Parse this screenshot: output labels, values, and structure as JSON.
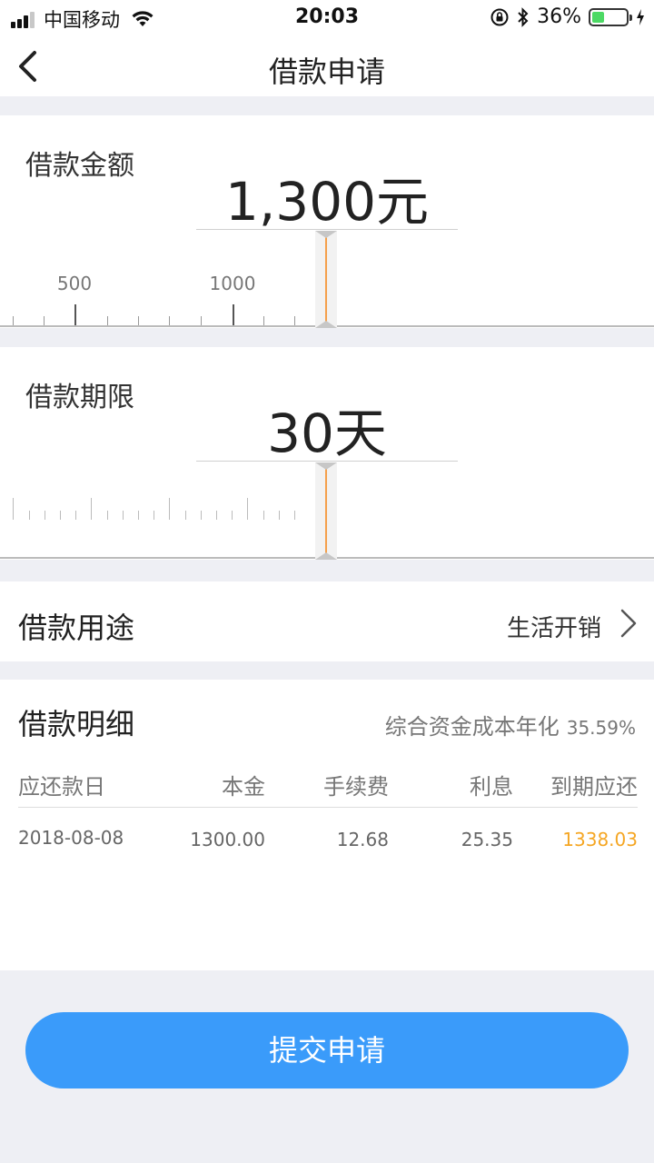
{
  "status": {
    "carrier": "中国移动",
    "time": "20:03",
    "battery": "36%",
    "battery_level": 0.36
  },
  "nav": {
    "title": "借款申请"
  },
  "amount": {
    "label": "借款金额",
    "value": "1,300元",
    "scale_labels": [
      "500",
      "1000"
    ]
  },
  "term": {
    "label": "借款期限",
    "value": "30天"
  },
  "purpose": {
    "label": "借款用途",
    "value": "生活开销"
  },
  "details": {
    "title": "借款明细",
    "rate_label": "综合资金成本年化",
    "rate_value": "35.59%",
    "columns": [
      "应还款日",
      "本金",
      "手续费",
      "利息",
      "到期应还"
    ],
    "rows": [
      [
        "2018-08-08",
        "1300.00",
        "12.68",
        "25.35",
        "1338.03"
      ]
    ]
  },
  "submit_label": "提交申请",
  "colors": {
    "accent": "#3a9bfa",
    "pointer": "#f5a04b",
    "due_amount": "#f5a623",
    "battery": "#4cd964"
  }
}
